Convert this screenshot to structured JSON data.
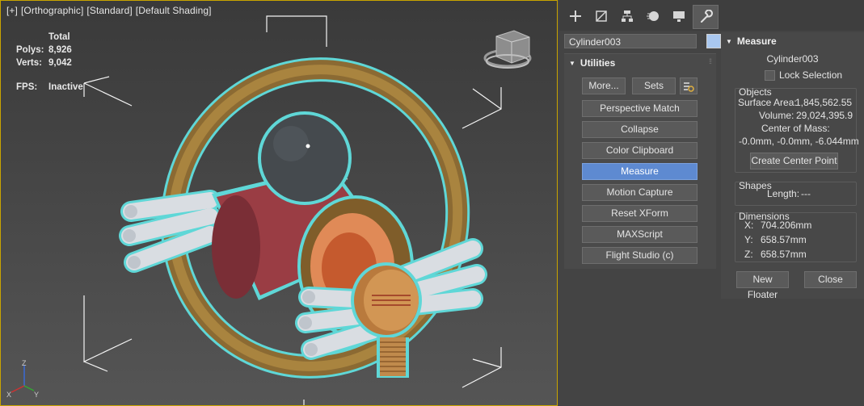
{
  "viewport": {
    "labels": [
      "[+]",
      "[Orthographic]",
      "[Standard]",
      "[Default Shading]"
    ],
    "stats": {
      "header": "Total",
      "rows": [
        {
          "label": "Polys:",
          "value": "8,926"
        },
        {
          "label": "Verts:",
          "value": "9,042"
        }
      ],
      "fps_label": "FPS:",
      "fps_value": "Inactive"
    },
    "viewcube_icon": "viewcube-icon",
    "axis_labels": {
      "z": "Z",
      "x": "X",
      "y": "Y"
    }
  },
  "command_panel": {
    "tabs": [
      {
        "name": "create-tab",
        "icon": "plus-icon"
      },
      {
        "name": "modify-tab",
        "icon": "modify-icon"
      },
      {
        "name": "hierarchy-tab",
        "icon": "hierarchy-icon"
      },
      {
        "name": "motion-tab",
        "icon": "motion-icon"
      },
      {
        "name": "display-tab",
        "icon": "display-icon"
      },
      {
        "name": "utilities-tab",
        "icon": "wrench-icon",
        "active": true
      }
    ],
    "object_name": "Cylinder003",
    "object_color": "#a9c7ef",
    "utilities": {
      "title": "Utilities",
      "more_label": "More...",
      "sets_label": "Sets",
      "buttons": [
        {
          "label": "Perspective Match"
        },
        {
          "label": "Collapse"
        },
        {
          "label": "Color Clipboard"
        },
        {
          "label": "Measure",
          "selected": true
        },
        {
          "label": "Motion Capture"
        },
        {
          "label": "Reset XForm"
        },
        {
          "label": "MAXScript"
        },
        {
          "label": "Flight Studio (c)"
        }
      ]
    },
    "measure": {
      "title": "Measure",
      "object": "Cylinder003",
      "lock_selection": "Lock Selection",
      "objects_group": "Objects",
      "surface_area_label": "Surface Area:",
      "surface_area_value": "1,845,562.55",
      "volume_label": "Volume:",
      "volume_value": "29,024,395.9",
      "center_of_mass_label": "Center of Mass:",
      "center_of_mass_value": "-0.0mm, -0.0mm, -6.044mm",
      "create_center_point": "Create Center Point",
      "shapes_group": "Shapes",
      "length_label": "Length:",
      "length_value": "---",
      "dimensions_group": "Dimensions",
      "dims": [
        {
          "label": "X:",
          "value": "704.206mm"
        },
        {
          "label": "Y:",
          "value": "658.57mm"
        },
        {
          "label": "Z:",
          "value": "658.57mm"
        }
      ],
      "new_floater": "New Floater",
      "close": "Close"
    },
    "accent_color": "#5e8ad1"
  }
}
